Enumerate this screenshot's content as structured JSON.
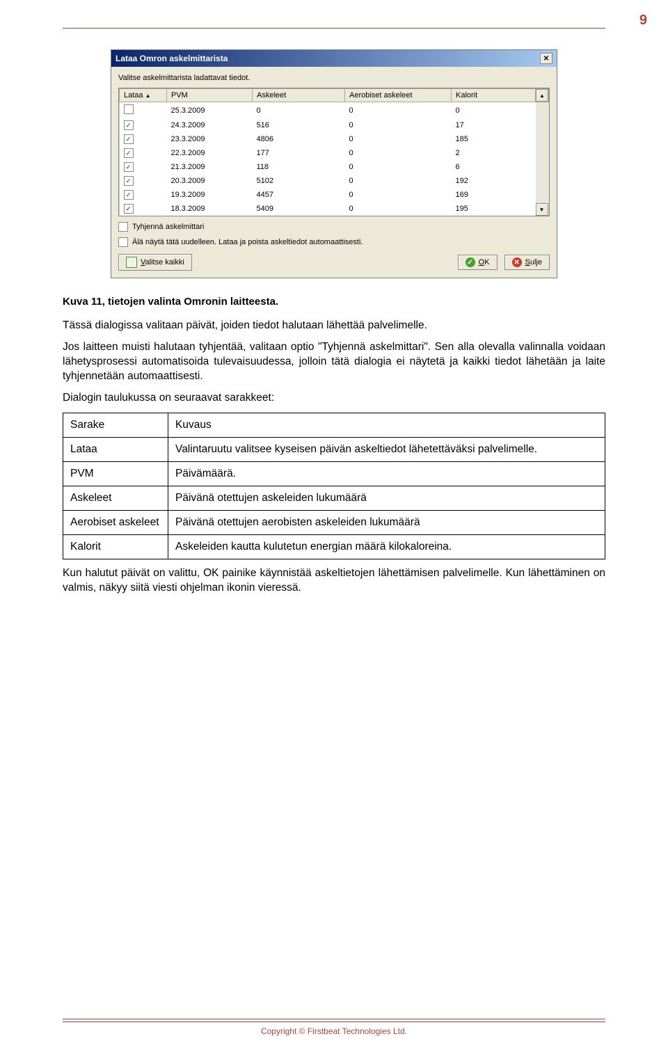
{
  "page_number": "9",
  "dialog": {
    "title": "Lataa Omron askelmittarista",
    "instruction": "Valitse askelmittarista ladattavat tiedot.",
    "columns": [
      "Lataa",
      "PVM",
      "Askeleet",
      "Aerobiset askeleet",
      "Kalorit"
    ],
    "rows": [
      {
        "checked": false,
        "pvm": "25.3.2009",
        "ask": "0",
        "aero": "0",
        "kal": "0"
      },
      {
        "checked": true,
        "pvm": "24.3.2009",
        "ask": "516",
        "aero": "0",
        "kal": "17"
      },
      {
        "checked": true,
        "pvm": "23.3.2009",
        "ask": "4806",
        "aero": "0",
        "kal": "185"
      },
      {
        "checked": true,
        "pvm": "22.3.2009",
        "ask": "177",
        "aero": "0",
        "kal": "2"
      },
      {
        "checked": true,
        "pvm": "21.3.2009",
        "ask": "118",
        "aero": "0",
        "kal": "6"
      },
      {
        "checked": true,
        "pvm": "20.3.2009",
        "ask": "5102",
        "aero": "0",
        "kal": "192"
      },
      {
        "checked": true,
        "pvm": "19.3.2009",
        "ask": "4457",
        "aero": "0",
        "kal": "169"
      },
      {
        "checked": true,
        "pvm": "18.3.2009",
        "ask": "5409",
        "aero": "0",
        "kal": "195"
      }
    ],
    "opt1": "Tyhjennä askelmittari",
    "opt2": "Älä näytä tätä uudelleen. Lataa ja poista askeltiedot automaattisesti.",
    "btn_select_all": "Valitse kaikki",
    "btn_ok": "OK",
    "btn_close": "Sulje"
  },
  "caption": "Kuva 11, tietojen valinta Omronin laitteesta.",
  "para1": "Tässä dialogissa valitaan päivät, joiden tiedot halutaan lähettää palvelimelle.",
  "para2": "Jos laitteen muisti halutaan tyhjentää, valitaan optio \"Tyhjennä askelmittari\". Sen alla olevalla valinnalla voidaan lähetysprosessi automatisoida tulevaisuudessa, jolloin tätä dialogia ei näytetä ja kaikki tiedot lähetään ja laite tyhjennetään automaattisesti.",
  "para3": "Dialogin taulukussa on seuraavat sarakkeet:",
  "desc_table": {
    "header": [
      "Sarake",
      "Kuvaus"
    ],
    "rows": [
      {
        "k": "Lataa",
        "v": "Valintaruutu valitsee kyseisen päivän askeltiedot lähetettäväksi palvelimelle."
      },
      {
        "k": "PVM",
        "v": "Päivämäärä."
      },
      {
        "k": "Askeleet",
        "v": "Päivänä otettujen askeleiden lukumäärä"
      },
      {
        "k": "Aerobiset askeleet",
        "v": "Päivänä otettujen aerobisten askeleiden lukumäärä"
      },
      {
        "k": "Kalorit",
        "v": "Askeleiden kautta kulutetun energian määrä kilokaloreina."
      }
    ]
  },
  "para4": "Kun halutut päivät on valittu, OK painike käynnistää askeltietojen lähettämisen palvelimelle. Kun lähettäminen on valmis, näkyy siitä viesti ohjelman ikonin vieressä.",
  "copyright": "Copyright © Firstbeat Technologies Ltd."
}
